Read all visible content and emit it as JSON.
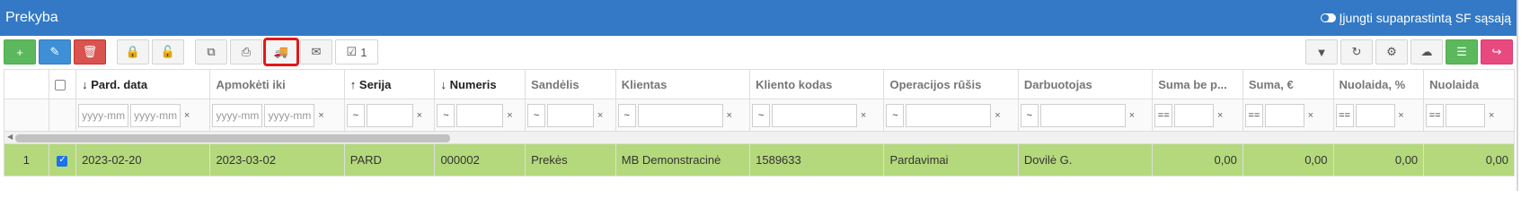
{
  "window": {
    "title": "Prekyba",
    "toggle_label": "Įjungti supaprastintą SF sąsają"
  },
  "toolbar": {
    "left": [
      {
        "name": "add-button",
        "icon": "plus-icon",
        "glyph": "+",
        "style": "green"
      },
      {
        "name": "edit-button",
        "icon": "pencil-icon",
        "glyph": "✎",
        "style": "blue"
      },
      {
        "name": "delete-button",
        "icon": "trash-icon",
        "glyph": "🗑",
        "style": "red"
      },
      {
        "name": "lock-button",
        "icon": "lock-icon",
        "glyph": "🔒",
        "style": ""
      },
      {
        "name": "unlock-button",
        "icon": "unlock-icon",
        "glyph": "🔓",
        "style": ""
      },
      {
        "name": "copy-button",
        "icon": "copy-icon",
        "glyph": "⧉",
        "style": ""
      },
      {
        "name": "print-button",
        "icon": "printer-icon",
        "glyph": "⎙",
        "style": ""
      },
      {
        "name": "delivery-button",
        "icon": "truck-icon",
        "glyph": "🚚",
        "style": "highlight"
      },
      {
        "name": "email-button",
        "icon": "envelope-icon",
        "glyph": "✉",
        "style": ""
      }
    ],
    "selected_count": "1",
    "right": [
      {
        "name": "filter-button",
        "icon": "filter-icon",
        "glyph": "▼",
        "style": ""
      },
      {
        "name": "refresh-button",
        "icon": "refresh-icon",
        "glyph": "↻",
        "style": ""
      },
      {
        "name": "settings-button",
        "icon": "gear-icon",
        "glyph": "⚙",
        "style": ""
      },
      {
        "name": "download-button",
        "icon": "cloud-download-icon",
        "glyph": "☁",
        "style": ""
      },
      {
        "name": "columns-button",
        "icon": "list-icon",
        "glyph": "☰",
        "style": "green"
      },
      {
        "name": "share-button",
        "icon": "share-icon",
        "glyph": "↪",
        "style": "pink"
      }
    ]
  },
  "grid": {
    "columns": [
      {
        "label": "↓ Pard. data",
        "bold": true
      },
      {
        "label": "Apmokėti iki",
        "bold": false
      },
      {
        "label": "↑ Serija",
        "bold": true
      },
      {
        "label": "↓ Numeris",
        "bold": true
      },
      {
        "label": "Sandėlis",
        "bold": false
      },
      {
        "label": "Klientas",
        "bold": false
      },
      {
        "label": "Kliento kodas",
        "bold": false
      },
      {
        "label": "Operacijos rūšis",
        "bold": false
      },
      {
        "label": "Darbuotojas",
        "bold": false
      },
      {
        "label": "Suma be p...",
        "bold": false
      },
      {
        "label": "Suma, €",
        "bold": false
      },
      {
        "label": "Nuolaida, %",
        "bold": false
      },
      {
        "label": "Nuolaida",
        "bold": false
      }
    ],
    "date_placeholder": "yyyy-mm",
    "text_op": "~",
    "num_op": "==",
    "clear": "×",
    "rows": [
      {
        "index": "1",
        "checked": true,
        "cells": [
          "2023-02-20",
          "2023-03-02",
          "PARD",
          "000002",
          "Prekės",
          "MB Demonstracinė",
          "1589633",
          "Pardavimai",
          "Dovilė G.",
          "0,00",
          "0,00",
          "0,00",
          "0,00"
        ]
      }
    ]
  }
}
